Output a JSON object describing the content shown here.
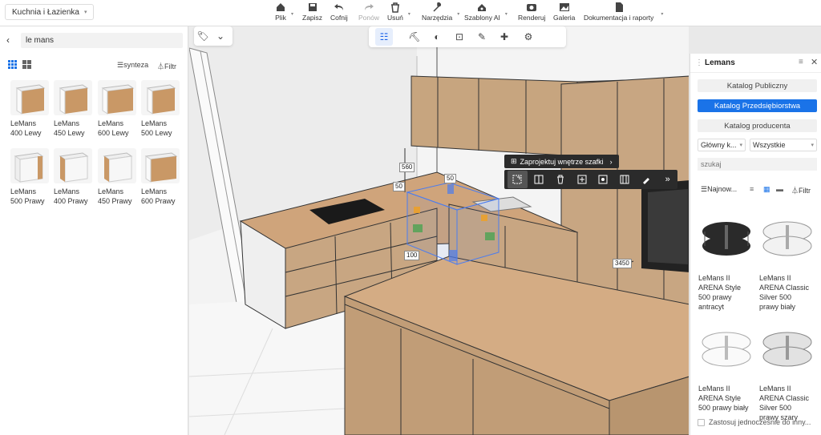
{
  "project": {
    "name": "Kuchnia i Łazienka"
  },
  "toolbar": {
    "items": [
      {
        "label": "Plik",
        "icon": "home-icon"
      },
      {
        "label": "Zapisz",
        "icon": "save-icon"
      },
      {
        "label": "Cofnij",
        "icon": "undo-icon"
      },
      {
        "label": "Ponów",
        "icon": "redo-icon"
      },
      {
        "label": "Usuń",
        "icon": "delete-icon"
      },
      {
        "label": "Narzędzia",
        "icon": "tools-icon"
      },
      {
        "label": "Szablony AI",
        "icon": "templates-ai-icon"
      },
      {
        "label": "Renderuj",
        "icon": "render-icon"
      },
      {
        "label": "Galeria",
        "icon": "gallery-icon"
      },
      {
        "label": "Dokumentacja i raporty",
        "icon": "docs-icon"
      }
    ]
  },
  "left": {
    "search_value": "le mans",
    "sort_label": "synteza",
    "filter_label": "Filtr",
    "products": [
      {
        "line1": "LeMans",
        "line2": "400 Lewy"
      },
      {
        "line1": "LeMans",
        "line2": "450 Lewy"
      },
      {
        "line1": "LeMans",
        "line2": "600 Lewy"
      },
      {
        "line1": "LeMans",
        "line2": "500 Lewy"
      },
      {
        "line1": "LeMans",
        "line2": "500 Prawy"
      },
      {
        "line1": "LeMans",
        "line2": "400 Prawy"
      },
      {
        "line1": "LeMans",
        "line2": "450 Prawy"
      },
      {
        "line1": "LeMans",
        "line2": "600 Prawy"
      }
    ]
  },
  "viewport": {
    "context_title": "Zaprojektuj wnętrze szafki",
    "dimensions": [
      "560",
      "50",
      "50",
      "100",
      "3450"
    ]
  },
  "right": {
    "title": "Lemans",
    "catalogs": [
      "Katalog Publiczny",
      "Katalog Przedsiębiorstwa",
      "Katalog producenta"
    ],
    "active_catalog": "Katalog Przedsiębiorstwa",
    "select_category": "Główny k...",
    "select_all": "Wszystkie",
    "search_placeholder": "szukaj",
    "sort_label": "Najnow...",
    "filter_label": "Filtr",
    "products": [
      {
        "lines": [
          "LeMans II",
          "ARENA Style",
          "500 prawy",
          "antracyt"
        ]
      },
      {
        "lines": [
          "LeMans II",
          "ARENA Classic",
          "Silver 500",
          "prawy biały"
        ]
      },
      {
        "lines": [
          "LeMans II",
          "ARENA Style",
          "500 prawy biały",
          ""
        ]
      },
      {
        "lines": [
          "LeMans II",
          "ARENA Classic",
          "Silver 500",
          "prawy szary"
        ]
      }
    ],
    "footer_checkbox": "Zastosuj jednocześnie do inny..."
  },
  "colors": {
    "accent": "#1a73e8",
    "wood": "#c99866",
    "dark_toolbar": "#2b2b2b"
  }
}
